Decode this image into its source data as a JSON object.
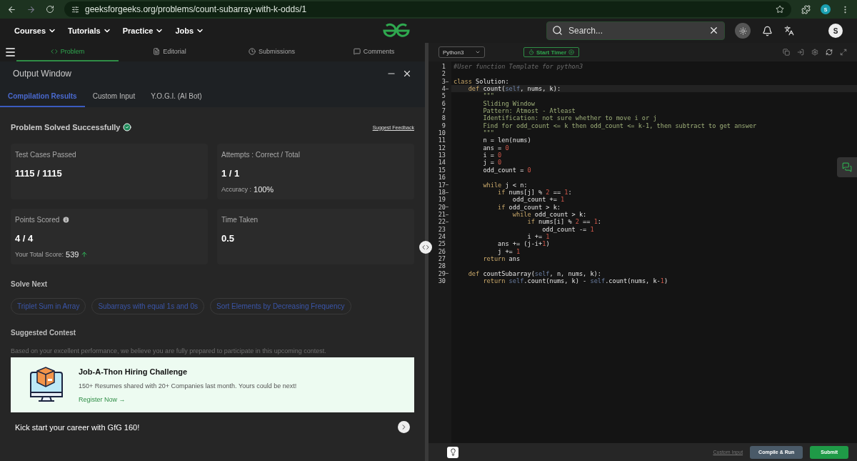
{
  "browser": {
    "url": "geeksforgeeks.org/problems/count-subarray-with-k-odds/1",
    "profile": "S"
  },
  "nav": {
    "menus": [
      "Courses",
      "Tutorials",
      "Practice",
      "Jobs"
    ],
    "search": {
      "placeholder": "Search..."
    },
    "avatar": "S"
  },
  "problem_tabs": [
    {
      "label": "Problem",
      "selected": true
    },
    {
      "label": "Editorial",
      "selected": false
    },
    {
      "label": "Submissions",
      "selected": false
    },
    {
      "label": "Comments",
      "selected": false
    }
  ],
  "output_window": {
    "title": "Output Window",
    "tabs": [
      {
        "label": "Compilation Results",
        "selected": true
      },
      {
        "label": "Custom Input",
        "selected": false
      },
      {
        "label": "Y.O.G.I. (AI Bot)",
        "selected": false
      }
    ],
    "status": "Problem Solved Successfully",
    "feedback_link": "Suggest Feedback",
    "cards": [
      {
        "label": "Test Cases Passed",
        "value": "1115 / 1115",
        "info": false
      },
      {
        "label": "Attempts : Correct / Total",
        "value": "1 / 1",
        "info": false,
        "extra_label": "Accuracy :",
        "extra_value": "100%",
        "trend": false
      },
      {
        "label": "Points Scored",
        "value": "4 / 4",
        "info": true,
        "extra_label": "Your Total Score:",
        "extra_value": "539",
        "trend": true
      },
      {
        "label": "Time Taken",
        "value": "0.5",
        "info": false
      }
    ],
    "solve_next_title": "Solve Next",
    "solve_next": [
      "Triplet Sum in Array",
      "Subarrays with equal 1s and 0s",
      "Sort Elements by Decreasing Frequency"
    ],
    "contest_title": "Suggested Contest",
    "contest_note": "Based on your excellent performance, we believe you are fully prepared to participate in this upcoming contest.",
    "contest": {
      "kind": "picture",
      "title": "Job-A-Thon Hiring Challenge",
      "text": "150+ Resumes shared with 20+ Companies last month. Yours could be next!",
      "link": "Register Now",
      "link_arrow": "→"
    },
    "promo": "Kick start your career with GfG 160!"
  },
  "editor": {
    "language": "Python3",
    "timer": "Start Timer",
    "lines": [
      {
        "number": "1",
        "fold": false,
        "active": false,
        "tokens": [
          {
            "kind": "cm",
            "text": "#User function Template for python3"
          }
        ]
      },
      {
        "number": "2",
        "fold": false,
        "active": false
      },
      {
        "number": "3",
        "fold": true,
        "active": false,
        "tokens": [
          {
            "kind": "kw",
            "text": "class"
          },
          {
            "kind": "p",
            "text": " Solution:"
          }
        ]
      },
      {
        "number": "4",
        "fold": true,
        "active": true,
        "tokens": [
          {
            "kind": "kw",
            "text": "    def"
          },
          {
            "kind": "p",
            "text": " count("
          },
          {
            "kind": "self",
            "text": "self"
          },
          {
            "kind": "p",
            "text": ", nums, k):"
          }
        ]
      },
      {
        "number": "5",
        "fold": false,
        "active": false,
        "tokens": [
          {
            "kind": "str",
            "text": "        \"\"\""
          }
        ]
      },
      {
        "number": "6",
        "fold": false,
        "active": false,
        "tokens": [
          {
            "kind": "str",
            "text": "        Sliding Window"
          }
        ]
      },
      {
        "number": "7",
        "fold": false,
        "active": false,
        "tokens": [
          {
            "kind": "str",
            "text": "        Pattern: Atmost - Atleast"
          }
        ]
      },
      {
        "number": "8",
        "fold": false,
        "active": false,
        "tokens": [
          {
            "kind": "str",
            "text": "        Identification: not sure whether to move i or j"
          }
        ]
      },
      {
        "number": "9",
        "fold": false,
        "active": false,
        "tokens": [
          {
            "kind": "str",
            "text": "        Find for odd_count <= k then odd_count <= k-1, then subtract to get answer"
          }
        ]
      },
      {
        "number": "10",
        "fold": false,
        "active": false,
        "tokens": [
          {
            "kind": "str",
            "text": "        \"\"\""
          }
        ]
      },
      {
        "number": "11",
        "fold": false,
        "active": false,
        "tokens": [
          {
            "kind": "p",
            "text": "        n = len(nums)"
          }
        ]
      },
      {
        "number": "12",
        "fold": false,
        "active": false,
        "tokens": [
          {
            "kind": "p",
            "text": "        ans = "
          },
          {
            "kind": "num",
            "text": "0"
          }
        ]
      },
      {
        "number": "13",
        "fold": false,
        "active": false,
        "tokens": [
          {
            "kind": "p",
            "text": "        i = "
          },
          {
            "kind": "num",
            "text": "0"
          }
        ]
      },
      {
        "number": "14",
        "fold": false,
        "active": false,
        "tokens": [
          {
            "kind": "p",
            "text": "        j = "
          },
          {
            "kind": "num",
            "text": "0"
          }
        ]
      },
      {
        "number": "15",
        "fold": false,
        "active": false,
        "tokens": [
          {
            "kind": "p",
            "text": "        odd_count = "
          },
          {
            "kind": "num",
            "text": "0"
          }
        ]
      },
      {
        "number": "16",
        "fold": false,
        "active": false
      },
      {
        "number": "17",
        "fold": true,
        "active": false,
        "tokens": [
          {
            "kind": "kw",
            "text": "        while"
          },
          {
            "kind": "p",
            "text": " j < n:"
          }
        ]
      },
      {
        "number": "18",
        "fold": true,
        "active": false,
        "tokens": [
          {
            "kind": "kw",
            "text": "            if"
          },
          {
            "kind": "p",
            "text": " nums[j] % "
          },
          {
            "kind": "num",
            "text": "2"
          },
          {
            "kind": "p",
            "text": " == "
          },
          {
            "kind": "num",
            "text": "1"
          },
          {
            "kind": "p",
            "text": ":"
          }
        ]
      },
      {
        "number": "19",
        "fold": false,
        "active": false,
        "tokens": [
          {
            "kind": "p",
            "text": "                odd_count += "
          },
          {
            "kind": "num",
            "text": "1"
          }
        ]
      },
      {
        "number": "20",
        "fold": true,
        "active": false,
        "tokens": [
          {
            "kind": "kw",
            "text": "            if"
          },
          {
            "kind": "p",
            "text": " odd_count > k:"
          }
        ]
      },
      {
        "number": "21",
        "fold": true,
        "active": false,
        "tokens": [
          {
            "kind": "kw",
            "text": "                while"
          },
          {
            "kind": "p",
            "text": " odd_count > k:"
          }
        ]
      },
      {
        "number": "22",
        "fold": true,
        "active": false,
        "tokens": [
          {
            "kind": "kw",
            "text": "                    if"
          },
          {
            "kind": "p",
            "text": " nums[i] % "
          },
          {
            "kind": "num",
            "text": "2"
          },
          {
            "kind": "p",
            "text": " == "
          },
          {
            "kind": "num",
            "text": "1"
          },
          {
            "kind": "p",
            "text": ":"
          }
        ]
      },
      {
        "number": "23",
        "fold": false,
        "active": false,
        "tokens": [
          {
            "kind": "p",
            "text": "                        odd_count -= "
          },
          {
            "kind": "num",
            "text": "1"
          }
        ]
      },
      {
        "number": "24",
        "fold": false,
        "active": false,
        "tokens": [
          {
            "kind": "p",
            "text": "                    i += "
          },
          {
            "kind": "num",
            "text": "1"
          }
        ]
      },
      {
        "number": "25",
        "fold": false,
        "active": false,
        "tokens": [
          {
            "kind": "p",
            "text": "            ans += (j-i+"
          },
          {
            "kind": "num",
            "text": "1"
          },
          {
            "kind": "p",
            "text": ")"
          }
        ]
      },
      {
        "number": "26",
        "fold": false,
        "active": false,
        "tokens": [
          {
            "kind": "p",
            "text": "            j += "
          },
          {
            "kind": "num",
            "text": "1"
          }
        ]
      },
      {
        "number": "27",
        "fold": false,
        "active": false,
        "tokens": [
          {
            "kind": "kw",
            "text": "        return"
          },
          {
            "kind": "p",
            "text": " ans"
          }
        ]
      },
      {
        "number": "28",
        "fold": false,
        "active": false
      },
      {
        "number": "29",
        "fold": true,
        "active": false,
        "tokens": [
          {
            "kind": "kw",
            "text": "    def"
          },
          {
            "kind": "p",
            "text": " countSubarray("
          },
          {
            "kind": "self",
            "text": "self"
          },
          {
            "kind": "p",
            "text": ", n, nums, k):"
          }
        ]
      },
      {
        "number": "30",
        "fold": false,
        "active": false,
        "tokens": [
          {
            "kind": "kw",
            "text": "        return"
          },
          {
            "kind": "self",
            "text": " self"
          },
          {
            "kind": "p",
            "text": ".count(nums, k) - "
          },
          {
            "kind": "self",
            "text": "self"
          },
          {
            "kind": "p",
            "text": ".count(nums, k-"
          },
          {
            "kind": "num",
            "text": "1"
          },
          {
            "kind": "p",
            "text": ")"
          }
        ]
      }
    ],
    "footer": {
      "custom_input": "Custom Input",
      "compile": "Compile & Run",
      "submit": "Submit"
    }
  }
}
